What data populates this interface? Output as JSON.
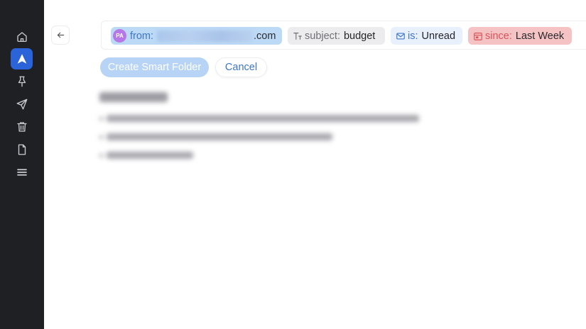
{
  "sidebar": {
    "items": [
      {
        "icon": "home-icon"
      },
      {
        "icon": "spark-logo-icon",
        "active": true
      },
      {
        "icon": "pin-icon"
      },
      {
        "icon": "send-icon"
      },
      {
        "icon": "trash-icon"
      },
      {
        "icon": "document-icon"
      },
      {
        "icon": "menu-icon"
      }
    ]
  },
  "filters": {
    "from": {
      "avatar": "PA",
      "key": "from:",
      "value": ".com"
    },
    "subject": {
      "key": "subject:",
      "value": "budget"
    },
    "is": {
      "key": "is:",
      "value": "Unread"
    },
    "since": {
      "key": "since:",
      "value": "Last Week"
    }
  },
  "actions": {
    "create_label": "Create Smart Folder",
    "cancel_label": "Cancel"
  },
  "colors": {
    "sidebar_bg": "#1f2024",
    "accent": "#2b63d8",
    "from_chip": "#bcd9f6",
    "subject_chip": "#ececee",
    "is_chip": "#e7f0fb",
    "since_chip": "#f5c3c3"
  }
}
